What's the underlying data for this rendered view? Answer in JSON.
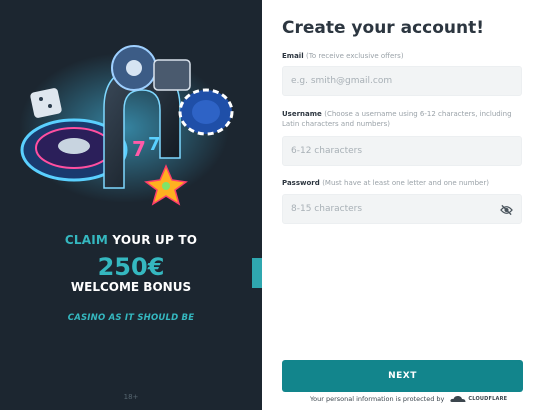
{
  "promo": {
    "claim_prefix": "CLAIM",
    "claim_rest": "YOUR UP TO",
    "amount": "250€",
    "welcome": "WELCOME BONUS",
    "tagline": "CASINO AS IT SHOULD BE",
    "bottom_mark": "18+"
  },
  "form": {
    "title": "Create your account!",
    "email": {
      "label": "Email",
      "hint": "(To receive exclusive offers)",
      "placeholder": "e.g. smith@gmail.com"
    },
    "username": {
      "label": "Username",
      "hint": "(Choose a username using 6-12 characters, including Latin characters and numbers)",
      "placeholder": "6-12 characters"
    },
    "password": {
      "label": "Password",
      "hint": "(Must have at least one letter and one number)",
      "placeholder": "8-15 characters",
      "toggle_icon": "eye-off-icon"
    },
    "next_label": "NEXT",
    "protected_text": "Your personal information is protected by",
    "protected_brand": "CLOUDFLARE"
  },
  "colors": {
    "panel_bg": "#1c2630",
    "accent": "#35b8c0",
    "button": "#12858c"
  }
}
